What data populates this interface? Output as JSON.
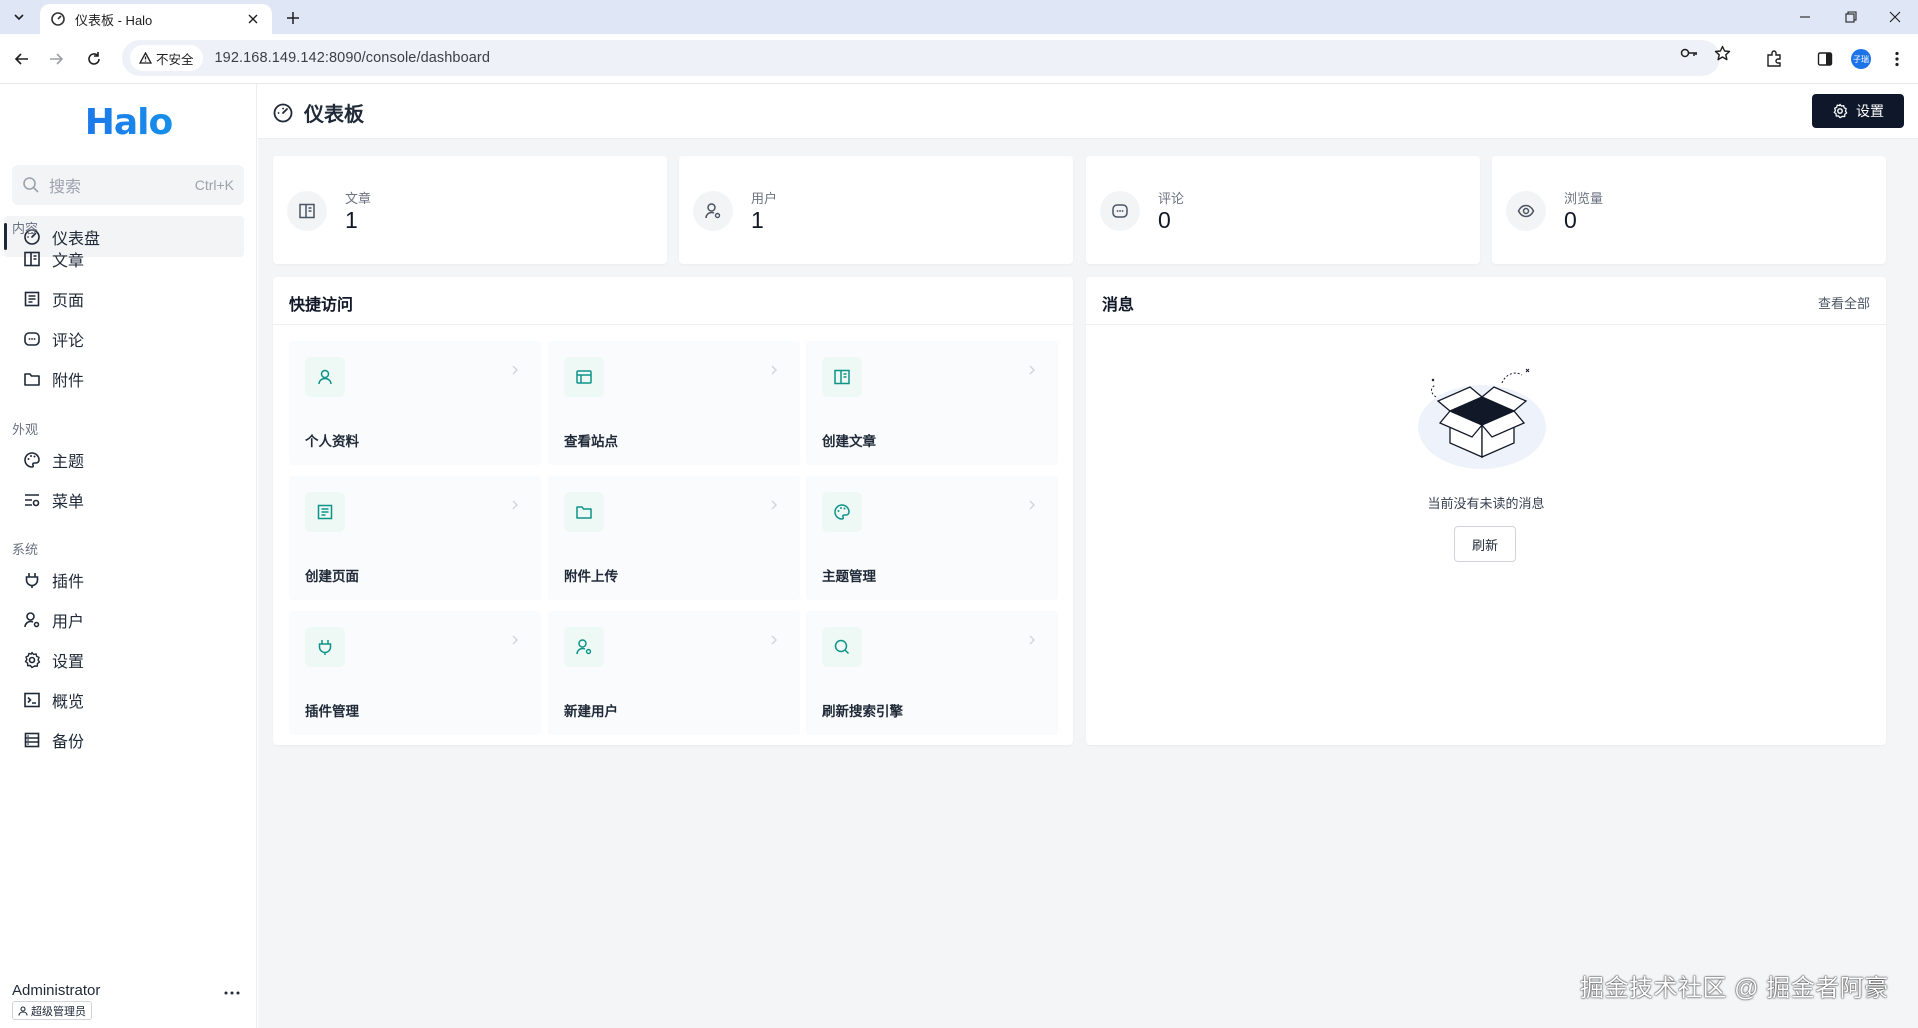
{
  "browser": {
    "tab_title": "仪表板 - Halo",
    "security_label": "不安全",
    "url": "192.168.149.142:8090/console/dashboard",
    "profile_initials": "子瑞"
  },
  "sidebar": {
    "logo": "Halo",
    "search_placeholder": "搜索",
    "search_shortcut": "Ctrl+K",
    "dashboard": {
      "label": "仪表盘",
      "icon": "dashboard-icon"
    },
    "groups": [
      {
        "title": "内容",
        "items": [
          {
            "label": "文章",
            "icon": "book-icon"
          },
          {
            "label": "页面",
            "icon": "page-icon"
          },
          {
            "label": "评论",
            "icon": "comment-icon"
          },
          {
            "label": "附件",
            "icon": "folder-icon"
          }
        ]
      },
      {
        "title": "外观",
        "items": [
          {
            "label": "主题",
            "icon": "palette-icon"
          },
          {
            "label": "菜单",
            "icon": "menu-settings-icon"
          }
        ]
      },
      {
        "title": "系统",
        "items": [
          {
            "label": "插件",
            "icon": "plug-icon"
          },
          {
            "label": "用户",
            "icon": "user-settings-icon"
          },
          {
            "label": "设置",
            "icon": "gear-icon"
          },
          {
            "label": "概览",
            "icon": "terminal-icon"
          },
          {
            "label": "备份",
            "icon": "database-icon"
          }
        ]
      }
    ],
    "user": {
      "name": "Administrator",
      "role": "超级管理员"
    }
  },
  "header": {
    "title": "仪表板",
    "settings_label": "设置"
  },
  "stats": [
    {
      "label": "文章",
      "value": "1",
      "icon": "book-icon"
    },
    {
      "label": "用户",
      "value": "1",
      "icon": "user-settings-icon"
    },
    {
      "label": "评论",
      "value": "0",
      "icon": "comment-icon"
    },
    {
      "label": "浏览量",
      "value": "0",
      "icon": "eye-icon"
    }
  ],
  "quick_access": {
    "title": "快捷访问",
    "items": [
      {
        "label": "个人资料",
        "icon": "user-icon"
      },
      {
        "label": "查看站点",
        "icon": "browser-window-icon"
      },
      {
        "label": "创建文章",
        "icon": "book-icon"
      },
      {
        "label": "创建页面",
        "icon": "page-icon"
      },
      {
        "label": "附件上传",
        "icon": "folder-icon"
      },
      {
        "label": "主题管理",
        "icon": "palette-icon"
      },
      {
        "label": "插件管理",
        "icon": "plug-icon"
      },
      {
        "label": "新建用户",
        "icon": "user-settings-icon"
      },
      {
        "label": "刷新搜索引擎",
        "icon": "search-icon"
      }
    ]
  },
  "notifications": {
    "title": "消息",
    "view_all": "查看全部",
    "empty_text": "当前没有未读的消息",
    "refresh_label": "刷新"
  },
  "watermark": "掘金技术社区 @ 掘金者阿豪",
  "colors": {
    "accent": "#0f172a",
    "icon_teal": "#0d9488",
    "icon_bg": "#eef8f5"
  }
}
